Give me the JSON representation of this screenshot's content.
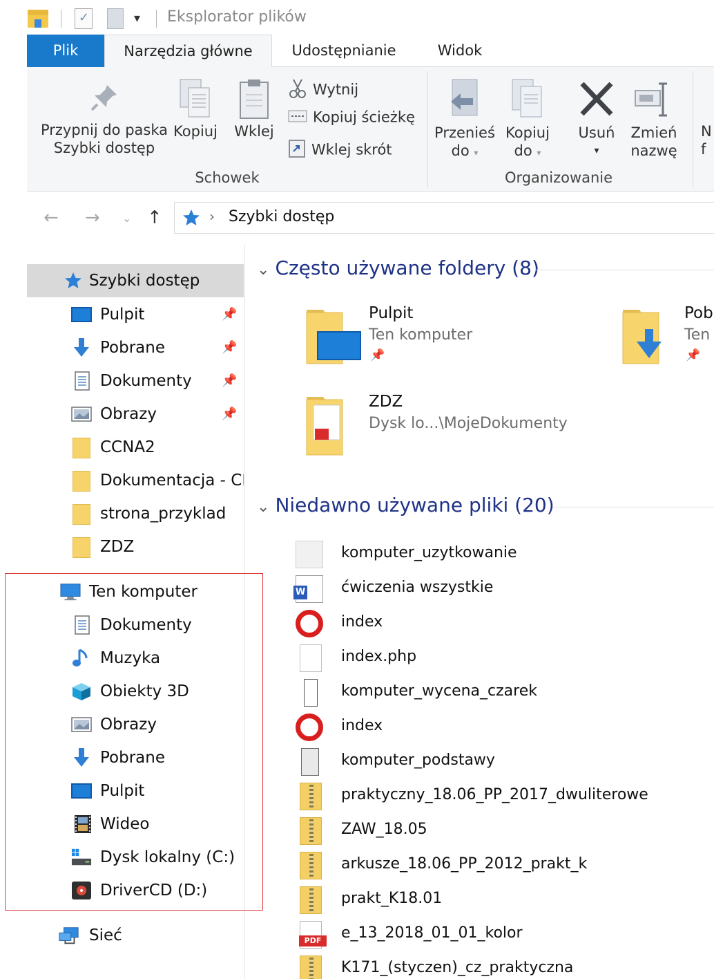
{
  "titlebar": {
    "title": "Eksplorator plików"
  },
  "ribbon_tabs": {
    "file": "Plik",
    "home": "Narzędzia główne",
    "share": "Udostępnianie",
    "view": "Widok"
  },
  "ribbon": {
    "pin_line1": "Przypnij do paska",
    "pin_line2": "Szybki dostęp",
    "copy": "Kopiuj",
    "paste": "Wklej",
    "cut": "Wytnij",
    "copy_path": "Kopiuj ścieżkę",
    "paste_shortcut": "Wklej skrót",
    "group_clipboard": "Schowek",
    "move_line1": "Przenieś",
    "move_line2": "do",
    "copyto_line1": "Kopiuj",
    "copyto_line2": "do",
    "delete": "Usuń",
    "rename_line1": "Zmień",
    "rename_line2": "nazwę",
    "group_organize": "Organizowanie",
    "new_cut_line1": "N",
    "new_cut_line2": "f"
  },
  "address": {
    "crumb": "Szybki dostęp"
  },
  "sidebar": {
    "quick_access": "Szybki dostęp",
    "qa_items": [
      "Pulpit",
      "Pobrane",
      "Dokumenty",
      "Obrazy",
      "CCNA2",
      "Dokumentacja - CIS",
      "strona_przyklad",
      "ZDZ"
    ],
    "this_pc": "Ten komputer",
    "pc_items": [
      "Dokumenty",
      "Muzyka",
      "Obiekty 3D",
      "Obrazy",
      "Pobrane",
      "Pulpit",
      "Wideo",
      "Dysk lokalny (C:)",
      "DriverCD (D:)"
    ],
    "network": "Sieć"
  },
  "frequent": {
    "header": "Często używane foldery (8)",
    "tiles": [
      {
        "name": "Pulpit",
        "sub": "Ten komputer"
      },
      {
        "name": "Pob",
        "sub": "Ten"
      },
      {
        "name": "ZDZ",
        "sub": "Dysk lo...\\MojeDokumenty"
      }
    ]
  },
  "recent": {
    "header": "Niedawno używane pliki (20)",
    "files": [
      {
        "name": "komputer_uzytkowanie",
        "icon": "generic-doc-icon"
      },
      {
        "name": "ćwiczenia wszystkie",
        "icon": "word-doc-icon"
      },
      {
        "name": "index",
        "icon": "opera-icon"
      },
      {
        "name": "index.php",
        "icon": "blank-file-icon"
      },
      {
        "name": "komputer_wycena_czarek",
        "icon": "blank-file-icon"
      },
      {
        "name": "index",
        "icon": "opera-icon"
      },
      {
        "name": "komputer_podstawy",
        "icon": "app-file-icon"
      },
      {
        "name": "praktyczny_18.06_PP_2017_dwuliterowe",
        "icon": "zip-icon"
      },
      {
        "name": "ZAW_18.05",
        "icon": "zip-icon"
      },
      {
        "name": "arkusze_18.06_PP_2012_prakt_k",
        "icon": "zip-icon"
      },
      {
        "name": "prakt_K18.01",
        "icon": "zip-icon"
      },
      {
        "name": "e_13_2018_01_01_kolor",
        "icon": "pdf-icon"
      },
      {
        "name": "K171_(styczen)_cz_praktyczna",
        "icon": "zip-icon"
      }
    ]
  },
  "colors": {
    "accent": "#1979ca",
    "header_text": "#1e3287",
    "highlight_box": "#e03a3a"
  }
}
